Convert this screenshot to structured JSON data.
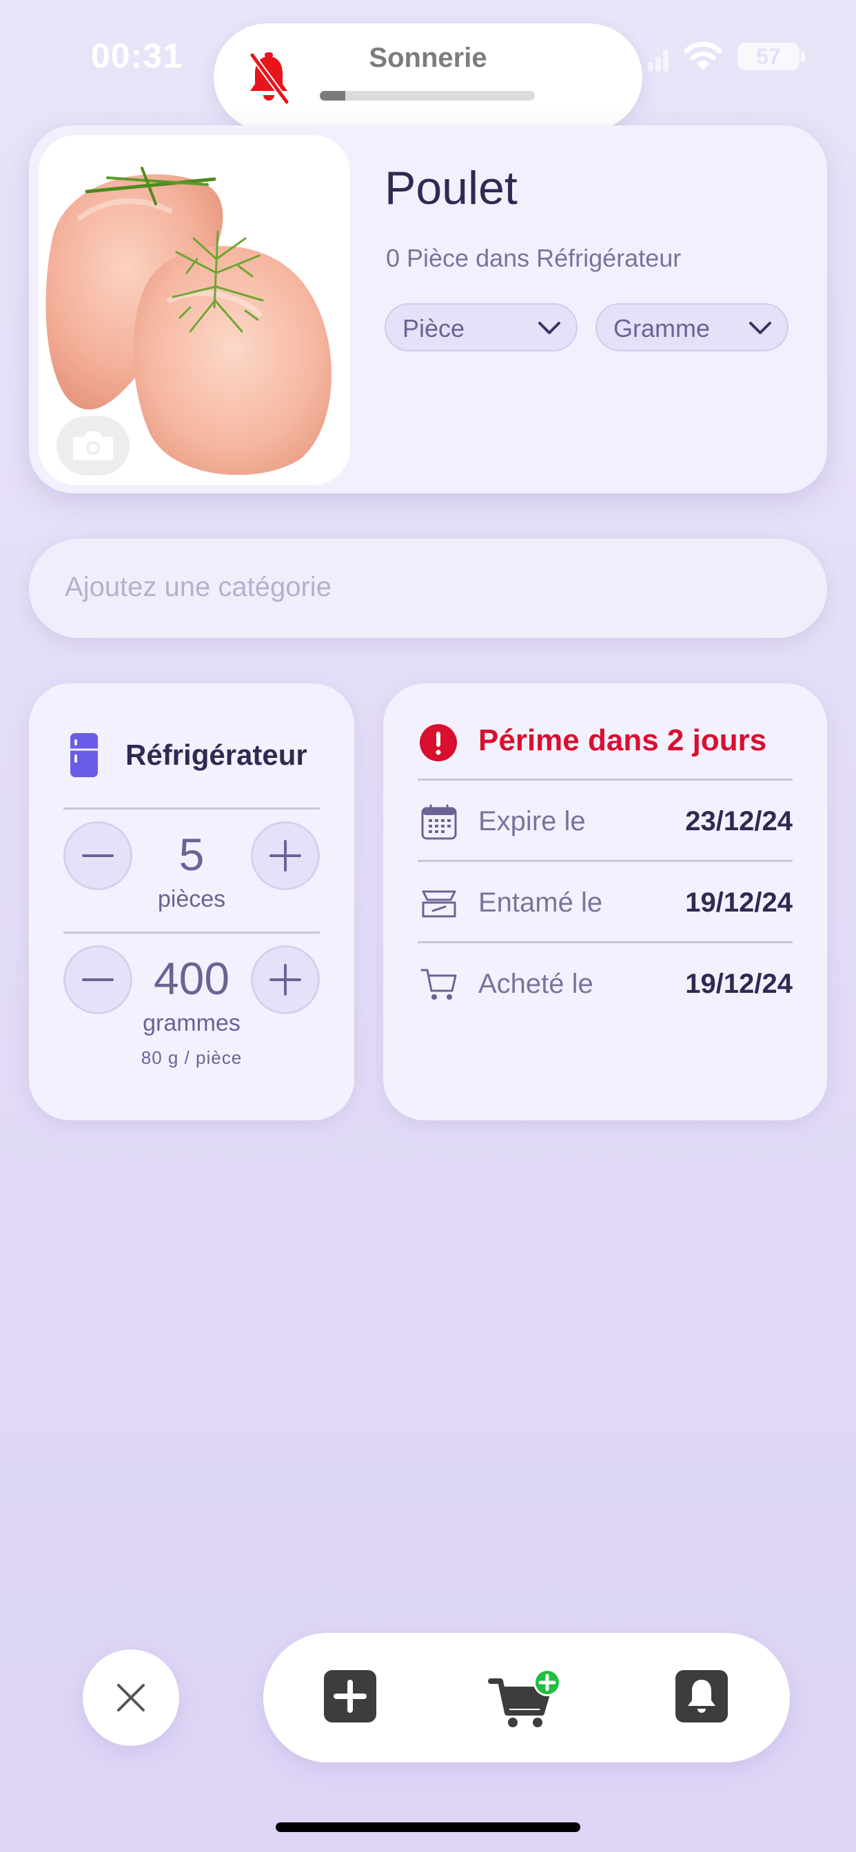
{
  "status_bar": {
    "time": "00:31",
    "battery": "57"
  },
  "ringer": {
    "title": "Sonnerie",
    "volume_fraction": 0.12,
    "icon": "bell-slash-icon"
  },
  "product": {
    "name": "Poulet",
    "stock_summary": "0 Pièce dans Réfrigérateur",
    "unit_primary": "Pièce",
    "unit_secondary": "Gramme"
  },
  "category": {
    "placeholder": "Ajoutez une catégorie"
  },
  "storage": {
    "location": "Réfrigérateur",
    "pieces_value": "5",
    "pieces_unit": "pièces",
    "grams_value": "400",
    "grams_unit": "grammes",
    "ratio": "80 g / pièce"
  },
  "dates": {
    "alert": "Périme dans 2 jours",
    "rows": [
      {
        "label": "Expire le",
        "value": "23/12/24",
        "icon": "calendar-icon"
      },
      {
        "label": "Entamé le",
        "value": "19/12/24",
        "icon": "opened-box-icon"
      },
      {
        "label": "Acheté le",
        "value": "19/12/24",
        "icon": "cart-icon"
      }
    ]
  },
  "colors": {
    "accent": "#6b5ce7",
    "alert": "#d80f2e",
    "badge_green": "#1fbf3f",
    "text_dark": "#2e2a52",
    "text_muted": "#7a739c"
  }
}
